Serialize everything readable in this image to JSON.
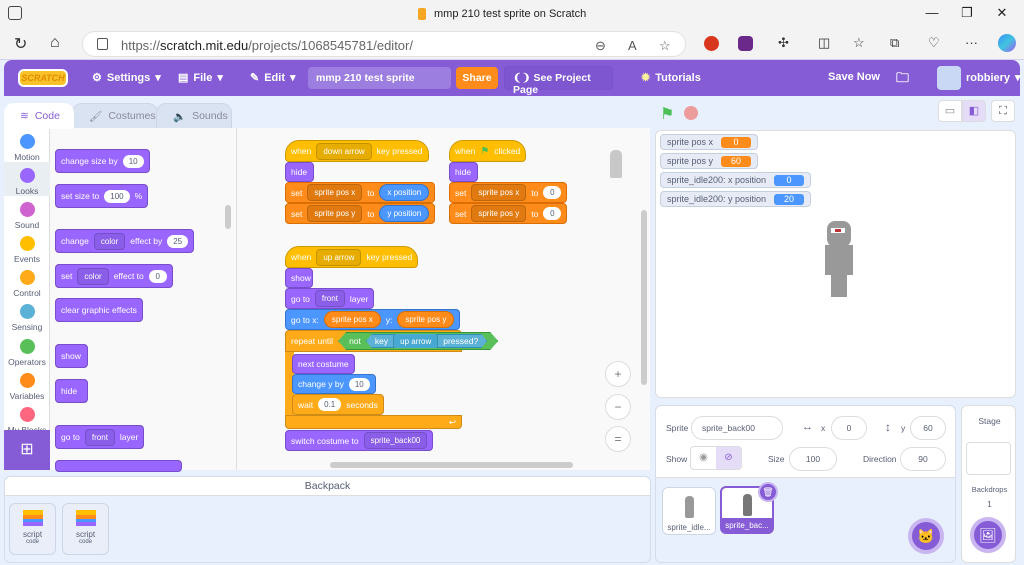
{
  "browser": {
    "tab_title": "mmp 210 test sprite on Scratch",
    "url_prefix": "https://",
    "url_host": "scratch.mit.edu",
    "url_path": "/projects/1068545781/editor/",
    "window_controls": {
      "minimize": "—",
      "restore": "❐",
      "close": "✕"
    },
    "icons": [
      "refresh-icon",
      "home-icon",
      "zoom-out-icon",
      "read-aloud-icon",
      "favorite-icon",
      "extension-red-icon",
      "extension-purple-icon",
      "extensions-icon",
      "split-screen-icon",
      "favorites-icon",
      "collections-icon",
      "browser-essentials-icon",
      "more-icon",
      "copilot-icon"
    ]
  },
  "menubar": {
    "logo": "SCRATCH",
    "settings": "Settings",
    "file": "File",
    "edit": "Edit",
    "project_title": "mmp 210 test sprite",
    "share": "Share",
    "see_project_page": "See Project Page",
    "tutorials": "Tutorials",
    "save_now": "Save Now",
    "username": "robbiery"
  },
  "tabs": [
    {
      "label": "Code",
      "active": true
    },
    {
      "label": "Costumes",
      "active": false
    },
    {
      "label": "Sounds",
      "active": false
    }
  ],
  "categories": [
    {
      "label": "Motion",
      "color": "#4c97ff"
    },
    {
      "label": "Looks",
      "color": "#9966ff",
      "selected": true
    },
    {
      "label": "Sound",
      "color": "#cf63cf"
    },
    {
      "label": "Events",
      "color": "#ffbf00"
    },
    {
      "label": "Control",
      "color": "#ffab19"
    },
    {
      "label": "Sensing",
      "color": "#5cb1d6"
    },
    {
      "label": "Operators",
      "color": "#59c059"
    },
    {
      "label": "Variables",
      "color": "#ff8c1a"
    },
    {
      "label": "My Blocks",
      "color": "#ff6680"
    }
  ],
  "palette": {
    "change_size": {
      "text": "change size by",
      "value": "10"
    },
    "set_size": {
      "text": "set size to",
      "value": "100",
      "suffix": "%"
    },
    "change_effect": {
      "text": "change",
      "dropdown": "color",
      "text2": "effect by",
      "value": "25"
    },
    "set_effect": {
      "text": "set",
      "dropdown": "color",
      "text2": "effect to",
      "value": "0"
    },
    "clear_effects": "clear graphic effects",
    "show": "show",
    "hide": "hide",
    "go_to_layer": {
      "text": "go to",
      "dropdown": "front",
      "text2": "layer"
    }
  },
  "scripts": {
    "down_arrow": {
      "when": "when",
      "key": "down arrow",
      "key_pressed": "key pressed",
      "hide": "hide",
      "set1": {
        "set": "set",
        "var": "sprite pos x",
        "to": "to",
        "value": "x position"
      },
      "set2": {
        "set": "set",
        "var": "sprite pos y",
        "to": "to",
        "value": "y position"
      }
    },
    "flag": {
      "when": "when",
      "clicked": "clicked",
      "hide": "hide",
      "set1": {
        "set": "set",
        "var": "sprite pos x",
        "to": "to",
        "value": "0"
      },
      "set2": {
        "set": "set",
        "var": "sprite pos y",
        "to": "to",
        "value": "0"
      }
    },
    "up_arrow": {
      "when": "when",
      "key": "up arrow",
      "key_pressed": "key pressed",
      "show": "show",
      "go_to_layer": {
        "text": "go to",
        "dropdown": "front",
        "text2": "layer"
      },
      "goto_xy": {
        "text": "go to x:",
        "x": "sprite pos x",
        "y_label": "y:",
        "y": "sprite pos y"
      },
      "repeat_until": {
        "text": "repeat until",
        "not": "not",
        "key": "key",
        "key_value": "up arrow",
        "pressed": "pressed?"
      },
      "next_costume": "next costume",
      "change_y": {
        "text": "change y by",
        "value": "10"
      },
      "wait": {
        "text": "wait",
        "value": "0.1",
        "unit": "seconds"
      },
      "switch_costume": {
        "text": "switch costume to",
        "value": "sprite_back00"
      }
    }
  },
  "zoom_controls": {
    "zoom_in": "+",
    "zoom_out": "−",
    "reset": "="
  },
  "backpack": {
    "title": "Backpack",
    "items": [
      {
        "label": "script",
        "sub": "code"
      },
      {
        "label": "script",
        "sub": "code"
      }
    ]
  },
  "stage": {
    "monitors": [
      {
        "label": "sprite pos x",
        "value": "0",
        "color": "#ff8c1a"
      },
      {
        "label": "sprite pos y",
        "value": "60",
        "color": "#ff8c1a"
      },
      {
        "label": "sprite_idle200: x position",
        "value": "0",
        "color": "#4c97ff"
      },
      {
        "label": "sprite_idle200: y position",
        "value": "20",
        "color": "#4c97ff"
      }
    ]
  },
  "sprite_info": {
    "sprite_label": "Sprite",
    "sprite_name": "sprite_back00",
    "x_label": "x",
    "x": "0",
    "y_label": "y",
    "y": "60",
    "show_label": "Show",
    "size_label": "Size",
    "size": "100",
    "direction_label": "Direction",
    "direction": "90"
  },
  "sprites": [
    {
      "name": "sprite_idle...",
      "selected": false
    },
    {
      "name": "sprite_bac...",
      "selected": true
    }
  ],
  "stage_pane": {
    "title": "Stage",
    "backdrops_label": "Backdrops",
    "backdrops_count": "1"
  }
}
